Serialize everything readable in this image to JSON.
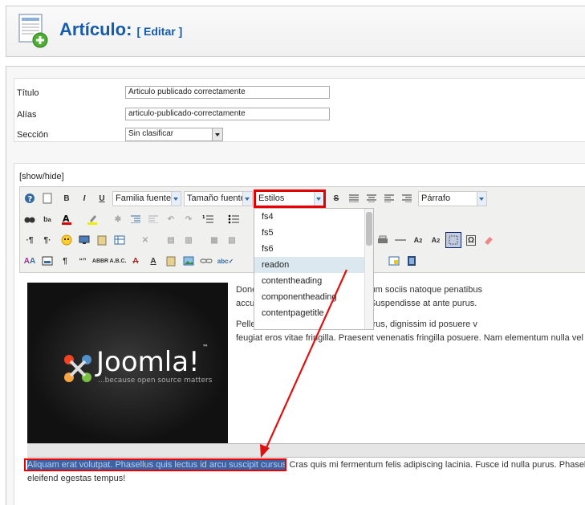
{
  "header": {
    "title": "Artículo:",
    "edit_label": "[ Editar ]"
  },
  "fields": {
    "titulo_label": "Título",
    "titulo_value": "Articulo publicado correctamente",
    "alias_label": "Alías",
    "alias_value": "articulo-publicado-correctamente",
    "seccion_label": "Sección",
    "seccion_value": "Sin clasificar"
  },
  "editor": {
    "showhide": "[show/hide]",
    "font_family": "Familia fuente",
    "font_size": "Tamaño fuente",
    "styles": "Estilos",
    "paragraph": "Párrafo",
    "styles_options": [
      "fs4",
      "fs5",
      "fs6",
      "readon",
      "contentheading",
      "componentheading",
      "contentpagetitle"
    ],
    "highlighted_option": "readon"
  },
  "content": {
    "para1_l1": "Done                                    stie. Aenean et lacus felis. Cum sociis natoque penatibus",
    "para1_l2": "accu                                    s nibh! Suspendisse potenti. Suspendisse at ante purus.",
    "para2_l1": "Pelle                                    acinia velit. Curabitur urna purus, dignissim id posuere v",
    "para2_l2": "feugiat eros vitae fringilla. Praesent venenatis fringilla posuere. Nam elementum nulla vel nis",
    "selected_text": "Aliquam erat volutpat. Phasellus quis lectus id arcu suscipit cursus",
    "after_selected": " Cras quis mi fermentum felis adipiscing lacinia. Fusce id nulla purus. Phasellus",
    "last_line": "eleifend egestas tempus!",
    "logo_word": "Joomla!",
    "logo_tm": "™",
    "logo_tagline": "...because open source matters"
  },
  "colors": {
    "title": "#135cae",
    "highlight_border": "#ee0000",
    "arrow": "#e01010"
  }
}
